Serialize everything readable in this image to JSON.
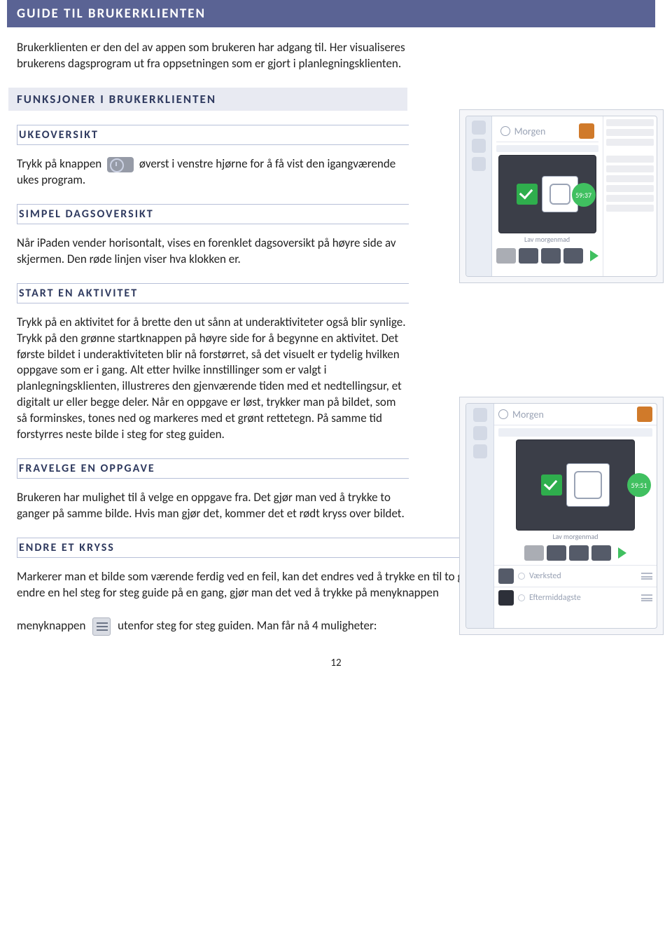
{
  "page": {
    "title": "GUIDE TIL BRUKERKLIENTEN",
    "intro": "Brukerklienten er den del av appen som brukeren har adgang til. Her visualiseres brukerens dagsprogram ut fra oppsetningen som er gjort i planlegningsklienten.",
    "pagenum": "12"
  },
  "sections": {
    "funksjoner": {
      "title": "FUNKSJONER I BRUKERKLIENTEN"
    },
    "ukeoversikt": {
      "title": "UKEOVERSIKT",
      "body_before": "Trykk på knappen",
      "body_after": "øverst i venstre hjørne for å få vist den igangværende ukes program."
    },
    "simpel": {
      "title": "SIMPEL DAGSOVERSIKT",
      "body": "Når iPaden vender horisontalt, vises en forenklet dagsoversikt på høyre side av skjermen. Den røde linjen viser hva klokken er."
    },
    "start": {
      "title": "START EN AKTIVITET",
      "body": "Trykk på en aktivitet for å brette den ut sånn at underaktiviteter også blir synlige. Trykk på den grønne startknappen på høyre side for å begynne en aktivitet. Det første bildet i underaktiviteten blir nå forstørret, så det visuelt er tydelig hvilken oppgave som er i gang. Alt etter hvilke innstillinger som er valgt i planlegningsklienten, illustreres den gjenværende tiden med et nedtellingsur, et digitalt ur eller begge deler. Når en oppgave er løst, trykker man på bildet, som så forminskes, tones ned og markeres med et grønt rettetegn. På samme tid forstyrres neste bilde i steg for steg guiden."
    },
    "fravelge": {
      "title": "FRAVELGE EN OPPGAVE",
      "body": "Brukeren har mulighet til å velge en oppgave fra. Det gjør man ved å trykke to ganger på samme bilde. Hvis man gjør det, kommer det et rødt kryss over bildet."
    },
    "endre": {
      "title": "ENDRE ET KRYSS",
      "body_before": "Markerer man et bilde som værende ferdig ved en feil, kan det endres ved å trykke en til to ganger til på bildet igjen. Hvis man skal endre en hel steg for steg guide på en gang, gjør man det ved å trykke på menyknappen",
      "body_after": "utenfor steg for steg guiden. Man får nå 4 muligheter:"
    }
  },
  "screenshots": {
    "s1": {
      "header": "Morgen",
      "timer": "59:37",
      "caption": "Lav morgenmad"
    },
    "s2": {
      "header": "Morgen",
      "timer": "59:51",
      "caption": "Lav morgenmad",
      "items": [
        "Værksted",
        "Eftermiddagste"
      ]
    }
  }
}
